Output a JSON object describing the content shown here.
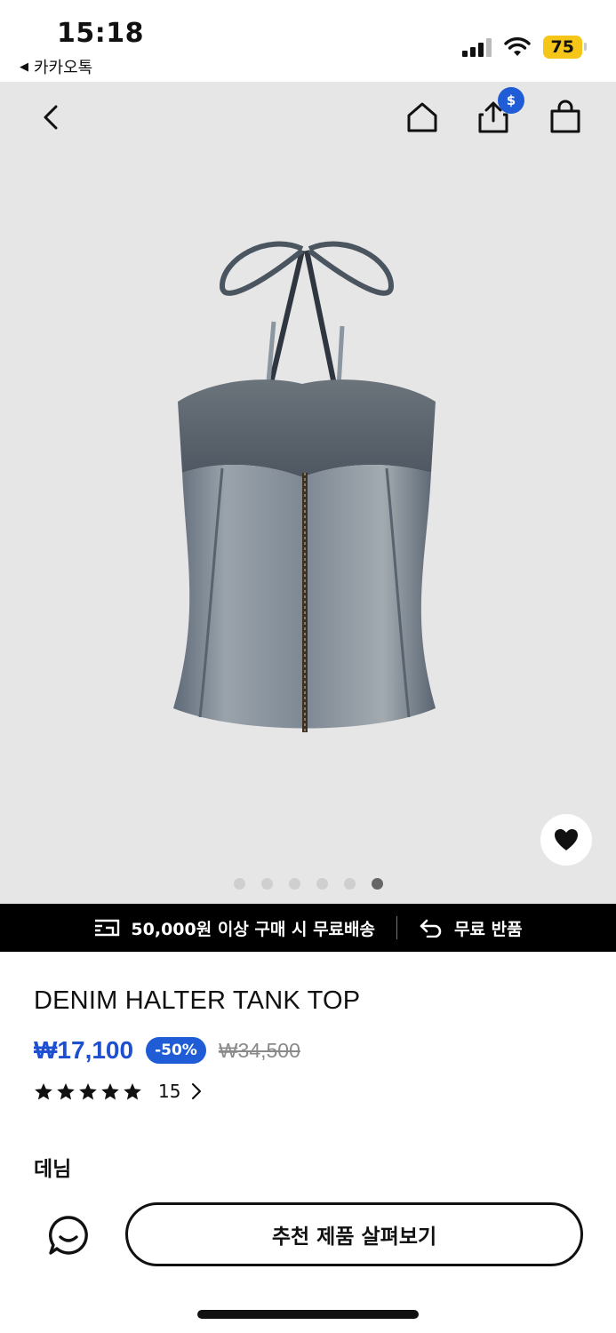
{
  "status_bar": {
    "time": "15:18",
    "back_app": "카카오톡",
    "battery": "75"
  },
  "icons": {
    "back": "chevron-left-icon",
    "home": "home-icon",
    "share": "share-icon",
    "share_badge": "$",
    "bag": "shopping-bag-icon",
    "wish": "heart-icon"
  },
  "gallery": {
    "image_count": 6,
    "active_index": 5
  },
  "promo": {
    "shipping": "50,000원 이상 구매 시 무료배송",
    "returns": "무료 반품"
  },
  "product": {
    "name": "DENIM HALTER TANK TOP",
    "price": "₩17,100",
    "discount": "-50%",
    "original_price": "₩34,500",
    "rating_stars": 5,
    "review_count": "15",
    "category": "데님"
  },
  "actions": {
    "recommend_button": "추천 제품 살펴보기"
  },
  "colors": {
    "accent": "#1f5cd6",
    "price": "#1f4fd1",
    "promo_bg": "#000000",
    "battery": "#f5c518"
  }
}
